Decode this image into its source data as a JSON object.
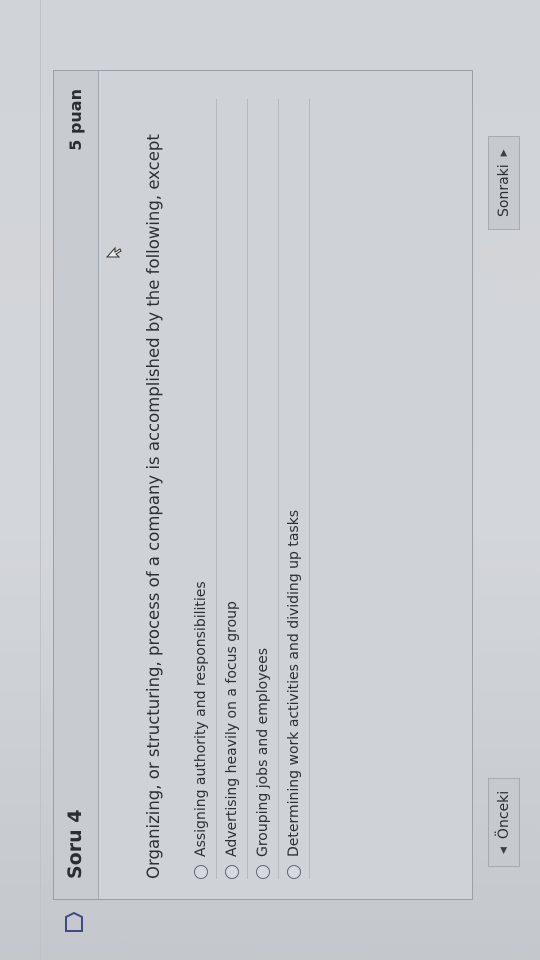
{
  "question": {
    "title": "Soru 4",
    "points": "5 puan",
    "text": "Organizing, or structuring, process of a company is accomplished by the following, except",
    "options": [
      "Assigning authority and responsibilities",
      "Advertising heavily on a focus group",
      "Grouping jobs and employees",
      "Determining work activities and dividing up tasks"
    ]
  },
  "nav": {
    "prev_label": "Önceki",
    "next_label": "Sonraki"
  },
  "icons": {
    "flag": "flag-icon",
    "cursor": "cursor-icon",
    "prev": "triangle-left-icon",
    "next": "triangle-right-icon"
  },
  "colors": {
    "background": "#c9cdd2",
    "text": "#2c3036",
    "border": "#9aa0a8"
  }
}
